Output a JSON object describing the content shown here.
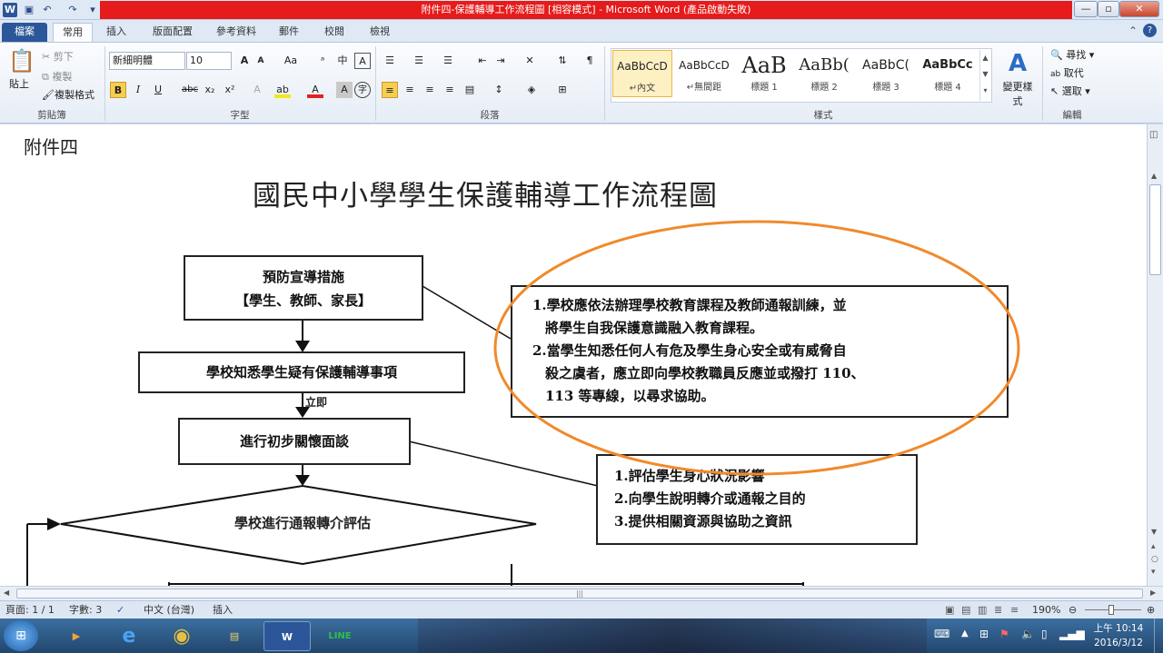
{
  "window": {
    "title": "附件四-保護輔導工作流程圖 [相容模式] - Microsoft Word (產品啟動失敗)",
    "controls": [
      "—",
      "▫",
      "✕"
    ]
  },
  "tabs": [
    "檔案",
    "常用",
    "插入",
    "版面配置",
    "參考資料",
    "郵件",
    "校閱",
    "檢視"
  ],
  "clipboard": {
    "cut": "剪下",
    "copy": "複製",
    "format_painter": "複製格式",
    "paste": "貼上",
    "label": "剪貼簿"
  },
  "font": {
    "family": "新細明體",
    "size": "10",
    "label": "字型"
  },
  "paragraph": {
    "label": "段落"
  },
  "styles": {
    "label": "樣式",
    "cards": [
      {
        "preview": "AaBbCcD",
        "name": "↵內文"
      },
      {
        "preview": "AaBbCcD",
        "name": "↵無間距"
      },
      {
        "preview": "AaB",
        "name": "標題 1"
      },
      {
        "preview": "AaBb(",
        "name": "標題 2"
      },
      {
        "preview": "AaBbC(",
        "name": "標題 3"
      },
      {
        "preview": "AaBbCc",
        "name": "標題 4"
      }
    ],
    "change": "變更樣式"
  },
  "editing": {
    "find": "尋找",
    "replace": "取代",
    "select": "選取",
    "label": "編輯"
  },
  "doc": {
    "attachment": "附件四",
    "title": "國民中小學學生保護輔導工作流程圖",
    "box1_line1": "預防宣導措施",
    "box1_line2": "【學生、教師、家長】",
    "box2": "學校知悉學生疑有保護輔導事項",
    "immediate": "立即",
    "box3": "進行初步關懷面談",
    "diamond": "學校進行通報轉介評估",
    "note1_l1": "1.學校應依法辦理學校教育課程及教師通報訓練，並",
    "note1_l2": "將學生自我保護意識融入教育課程。",
    "note1_l3": "2.當學生知悉任何人有危及學生身心安全或有威脅自",
    "note1_l4": "殺之虞者，應立即向學校教職員反應並或撥打 110、",
    "note1_l5": "113 等專線，以尋求協助。",
    "note2_l1": "1.評估學生身心狀況影響",
    "note2_l2": "2.向學生說明轉介或通報之目的",
    "note2_l3": "3.提供相關資源與協助之資訊"
  },
  "status": {
    "page": "頁面: 1 / 1",
    "words": "字數: 3",
    "lang": "中文 (台灣)",
    "mode": "插入",
    "zoom": "190%"
  },
  "clock": {
    "time": "上午 10:14",
    "date": "2016/3/12"
  },
  "colors": {
    "accent": "#2b579a",
    "highlight_oval": "#f08a2c",
    "title_bar": "#e61b1b"
  }
}
